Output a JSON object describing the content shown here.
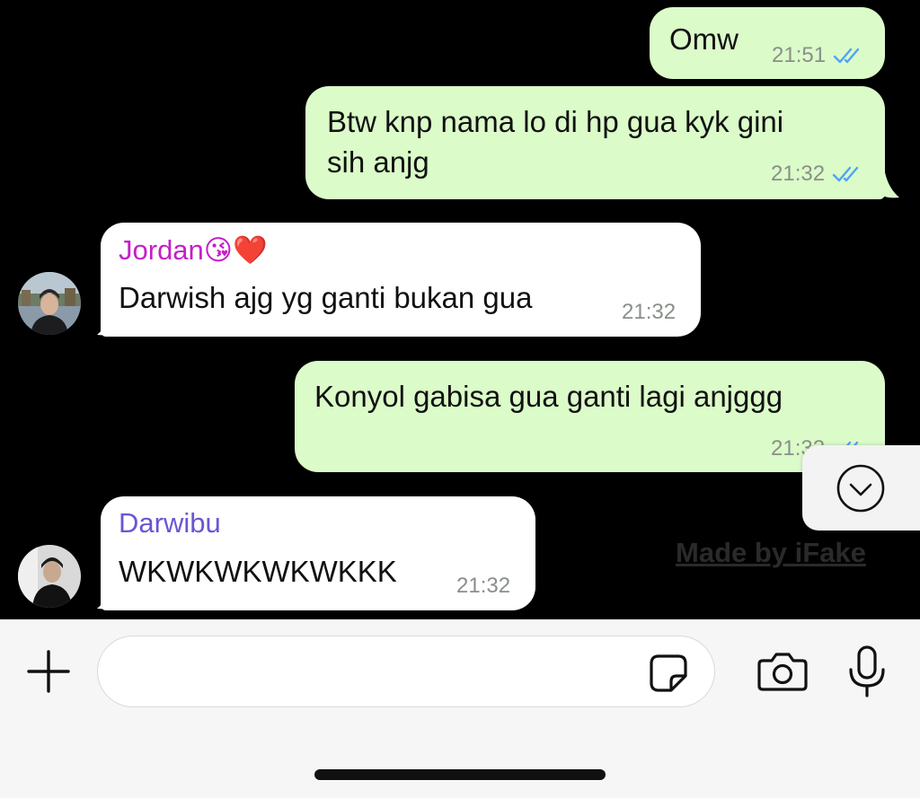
{
  "messages": [
    {
      "id": "m1",
      "direction": "outgoing",
      "text": "Omw",
      "time": "21:51",
      "status": "read"
    },
    {
      "id": "m2",
      "direction": "outgoing",
      "text_line1": "Btw knp nama lo di hp gua kyk gini",
      "text_line2": "sih anjg",
      "time": "21:32",
      "status": "read"
    },
    {
      "id": "m3",
      "direction": "incoming",
      "sender": "Jordan😘❤️",
      "text": "Darwish ajg yg ganti bukan gua",
      "time": "21:32"
    },
    {
      "id": "m4",
      "direction": "outgoing",
      "text": "Konyol gabisa gua ganti lagi anjggg",
      "time": "21:32",
      "status": "read"
    },
    {
      "id": "m5",
      "direction": "incoming",
      "sender": "Darwibu",
      "text": "WKWKWKWKWKKK",
      "time": "21:32"
    }
  ],
  "watermark": "Made by iFake",
  "input": {
    "placeholder": ""
  },
  "colors": {
    "outgoing_bubble": "#dbfbc9",
    "incoming_bubble": "#ffffff",
    "sender_jordan": "#c41fc9",
    "sender_darwibu": "#6a55d6",
    "read_ticks": "#4fa3f7",
    "background": "#000000"
  },
  "icons": {
    "attach": "plus-icon",
    "sticker": "sticker-icon",
    "camera": "camera-icon",
    "mic": "microphone-icon",
    "scroll": "chevron-down-circle-icon",
    "ticks": "double-check-icon"
  }
}
